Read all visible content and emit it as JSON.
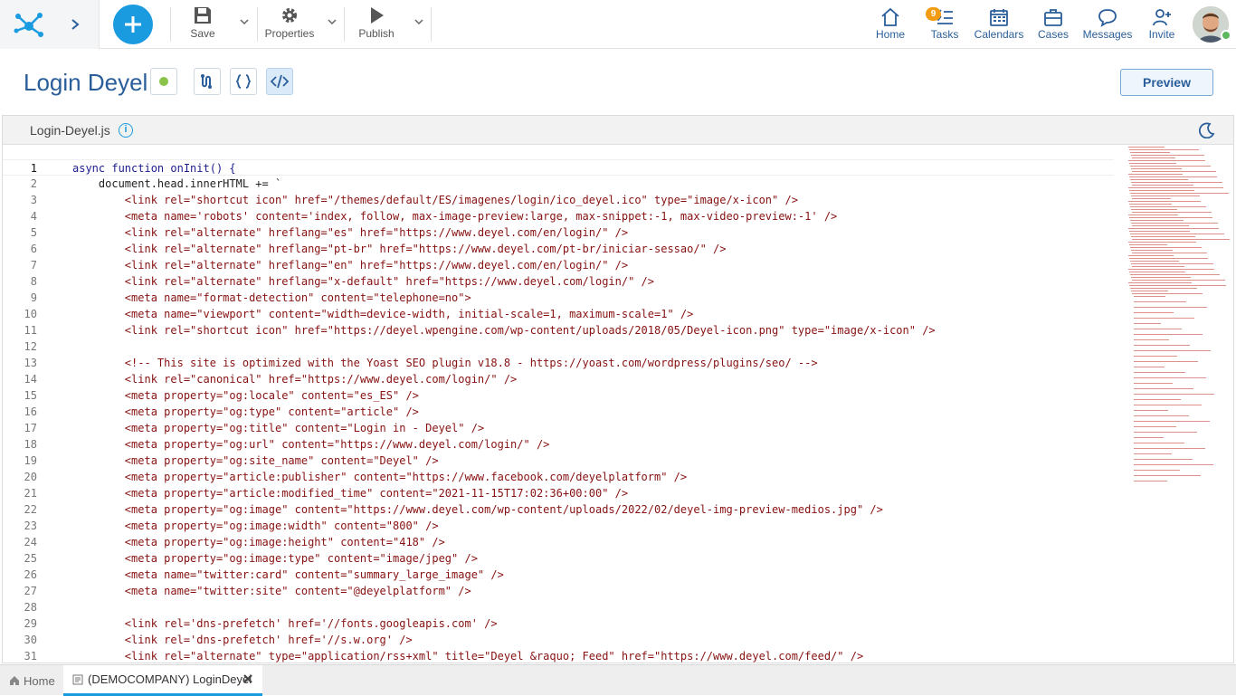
{
  "toolbar": {
    "save_label": "Save",
    "properties_label": "Properties",
    "publish_label": "Publish"
  },
  "nav": {
    "home": "Home",
    "tasks": "Tasks",
    "tasks_badge": "9",
    "calendars": "Calendars",
    "cases": "Cases",
    "messages": "Messages",
    "invite": "Invite"
  },
  "page": {
    "title": "Login Deyel",
    "preview_label": "Preview"
  },
  "editor": {
    "file_name": "Login-Deyel.js",
    "info_glyph": "i",
    "lines": [
      {
        "n": "1",
        "t": "async function onInit() {"
      },
      {
        "n": "2",
        "t": "    document.head.innerHTML += `"
      },
      {
        "n": "3",
        "t": "        <link rel=\"shortcut icon\" href=\"/themes/default/ES/imagenes/login/ico_deyel.ico\" type=\"image/x-icon\" />"
      },
      {
        "n": "4",
        "t": "        <meta name='robots' content='index, follow, max-image-preview:large, max-snippet:-1, max-video-preview:-1' />"
      },
      {
        "n": "5",
        "t": "        <link rel=\"alternate\" hreflang=\"es\" href=\"https://www.deyel.com/en/login/\" />"
      },
      {
        "n": "6",
        "t": "        <link rel=\"alternate\" hreflang=\"pt-br\" href=\"https://www.deyel.com/pt-br/iniciar-sessao/\" />"
      },
      {
        "n": "7",
        "t": "        <link rel=\"alternate\" hreflang=\"en\" href=\"https://www.deyel.com/en/login/\" />"
      },
      {
        "n": "8",
        "t": "        <link rel=\"alternate\" hreflang=\"x-default\" href=\"https://www.deyel.com/login/\" />"
      },
      {
        "n": "9",
        "t": "        <meta name=\"format-detection\" content=\"telephone=no\">"
      },
      {
        "n": "10",
        "t": "        <meta name=\"viewport\" content=\"width=device-width, initial-scale=1, maximum-scale=1\" />"
      },
      {
        "n": "11",
        "t": "        <link rel=\"shortcut icon\" href=\"https://deyel.wpengine.com/wp-content/uploads/2018/05/Deyel-icon.png\" type=\"image/x-icon\" />"
      },
      {
        "n": "12",
        "t": ""
      },
      {
        "n": "13",
        "t": "        <!-- This site is optimized with the Yoast SEO plugin v18.8 - https://yoast.com/wordpress/plugins/seo/ -->"
      },
      {
        "n": "14",
        "t": "        <link rel=\"canonical\" href=\"https://www.deyel.com/login/\" />"
      },
      {
        "n": "15",
        "t": "        <meta property=\"og:locale\" content=\"es_ES\" />"
      },
      {
        "n": "16",
        "t": "        <meta property=\"og:type\" content=\"article\" />"
      },
      {
        "n": "17",
        "t": "        <meta property=\"og:title\" content=\"Login in - Deyel\" />"
      },
      {
        "n": "18",
        "t": "        <meta property=\"og:url\" content=\"https://www.deyel.com/login/\" />"
      },
      {
        "n": "19",
        "t": "        <meta property=\"og:site_name\" content=\"Deyel\" />"
      },
      {
        "n": "20",
        "t": "        <meta property=\"article:publisher\" content=\"https://www.facebook.com/deyelplatform\" />"
      },
      {
        "n": "21",
        "t": "        <meta property=\"article:modified_time\" content=\"2021-11-15T17:02:36+00:00\" />"
      },
      {
        "n": "22",
        "t": "        <meta property=\"og:image\" content=\"https://www.deyel.com/wp-content/uploads/2022/02/deyel-img-preview-medios.jpg\" />"
      },
      {
        "n": "23",
        "t": "        <meta property=\"og:image:width\" content=\"800\" />"
      },
      {
        "n": "24",
        "t": "        <meta property=\"og:image:height\" content=\"418\" />"
      },
      {
        "n": "25",
        "t": "        <meta property=\"og:image:type\" content=\"image/jpeg\" />"
      },
      {
        "n": "26",
        "t": "        <meta name=\"twitter:card\" content=\"summary_large_image\" />"
      },
      {
        "n": "27",
        "t": "        <meta name=\"twitter:site\" content=\"@deyelplatform\" />"
      },
      {
        "n": "28",
        "t": ""
      },
      {
        "n": "29",
        "t": "        <link rel='dns-prefetch' href='//fonts.googleapis.com' />"
      },
      {
        "n": "30",
        "t": "        <link rel='dns-prefetch' href='//s.w.org' />"
      },
      {
        "n": "31",
        "t": "        <link rel=\"alternate\" type=\"application/rss+xml\" title=\"Deyel &raquo; Feed\" href=\"https://www.deyel.com/feed/\" />"
      }
    ]
  },
  "bottom_tabs": {
    "home": "Home",
    "active": "(DEMOCOMPANY) LoginDeyel"
  },
  "colors": {
    "accent": "#1a9be0",
    "title": "#2a5e9a",
    "status_dot": "#8bc34a",
    "badge": "#f39c12"
  }
}
